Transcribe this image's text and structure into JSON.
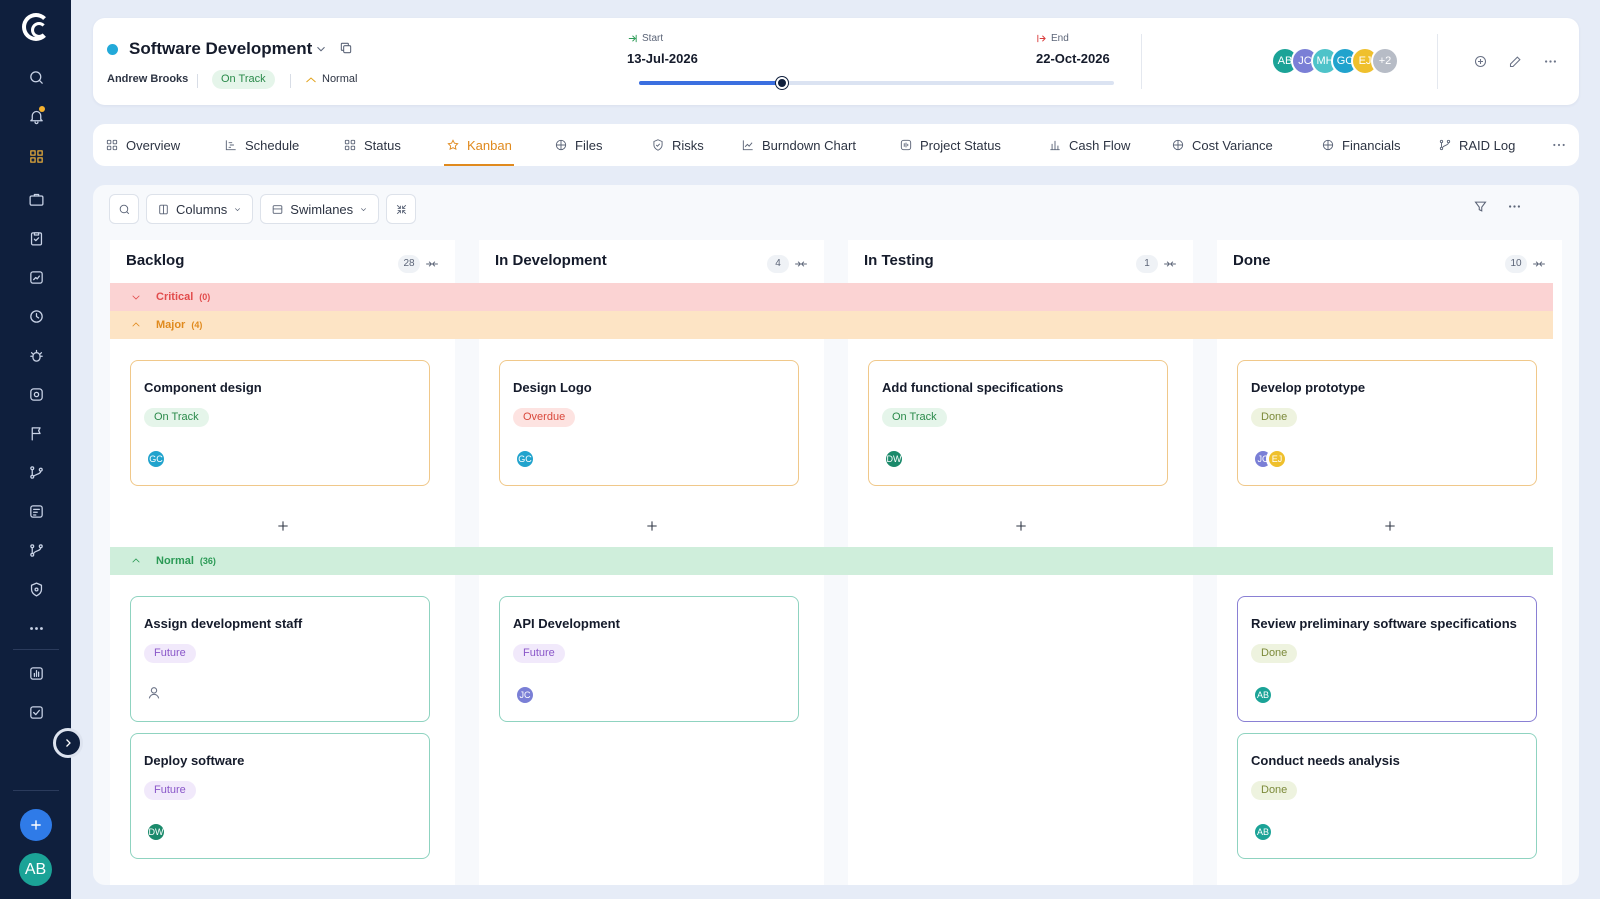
{
  "project": {
    "name": "Software Development",
    "owner": "Andrew Brooks",
    "status": "On Track",
    "priority": "Normal",
    "status_dot_color": "#22a9d9"
  },
  "schedule": {
    "start_label": "Start",
    "start_date": "13-Jul-2026",
    "end_label": "End",
    "end_date": "22-Oct-2026",
    "progress_percent": 30
  },
  "team": {
    "members": [
      {
        "initials": "AB",
        "color": "#1ba397"
      },
      {
        "initials": "JC",
        "color": "#7a7fd6"
      },
      {
        "initials": "MH",
        "color": "#4ec3c9"
      },
      {
        "initials": "GC",
        "color": "#21a3cd"
      },
      {
        "initials": "EJ",
        "color": "#efc02d"
      }
    ],
    "overflow": "+2",
    "overflow_color": "#b7bcc6"
  },
  "tabs": [
    {
      "label": "Overview",
      "icon": "grid-icon"
    },
    {
      "label": "Schedule",
      "icon": "gantt-icon"
    },
    {
      "label": "Status",
      "icon": "grid-icon"
    },
    {
      "label": "Kanban",
      "icon": "star-icon",
      "active": true
    },
    {
      "label": "Files",
      "icon": "table-icon"
    },
    {
      "label": "Risks",
      "icon": "shield-icon"
    },
    {
      "label": "Burndown Chart",
      "icon": "line-chart-icon"
    },
    {
      "label": "Project Status",
      "icon": "status-icon"
    },
    {
      "label": "Cash Flow",
      "icon": "bar-chart-icon"
    },
    {
      "label": "Cost Variance",
      "icon": "table-icon"
    },
    {
      "label": "Financials",
      "icon": "table-icon"
    },
    {
      "label": "RAID Log",
      "icon": "branch-icon"
    }
  ],
  "toolbar": {
    "columns_label": "Columns",
    "swimlanes_label": "Swimlanes"
  },
  "columns": [
    {
      "title": "Backlog",
      "count": "28"
    },
    {
      "title": "In Development",
      "count": "4"
    },
    {
      "title": "In Testing",
      "count": "1"
    },
    {
      "title": "Done",
      "count": "10"
    }
  ],
  "swimlanes": [
    {
      "name": "Critical",
      "count": "(0)",
      "bg": "#fbd3d3",
      "color": "#e24c4c",
      "expanded": false
    },
    {
      "name": "Major",
      "count": "(4)",
      "bg": "#fde4c5",
      "color": "#e08a1e",
      "expanded": true
    },
    {
      "name": "Normal",
      "count": "(36)",
      "bg": "#cfeedb",
      "color": "#2a9a55",
      "expanded": true
    }
  ],
  "cards": [
    {
      "title": "Component design",
      "status": "On Track",
      "status_kind": "green",
      "assignees": [
        {
          "initials": "GC",
          "color": "#21a3cd"
        }
      ],
      "border": "#f0c88a"
    },
    {
      "title": "Design Logo",
      "status": "Overdue",
      "status_kind": "red",
      "assignees": [
        {
          "initials": "GC",
          "color": "#21a3cd"
        }
      ],
      "border": "#f0c88a"
    },
    {
      "title": "Add functional specifications",
      "status": "On Track",
      "status_kind": "green",
      "assignees": [
        {
          "initials": "DW",
          "color": "#1b8a6b"
        }
      ],
      "border": "#f0c88a"
    },
    {
      "title": "Develop prototype",
      "status": "Done",
      "status_kind": "olive",
      "assignees": [
        {
          "initials": "JC",
          "color": "#7a7fd6"
        },
        {
          "initials": "EJ",
          "color": "#efc02d"
        }
      ],
      "border": "#f0c88a"
    },
    {
      "title": "Assign development staff",
      "status": "Future",
      "status_kind": "purple",
      "assignees": [],
      "border": "#8fd3c0"
    },
    {
      "title": "API Development",
      "status": "Future",
      "status_kind": "purple",
      "assignees": [
        {
          "initials": "JC",
          "color": "#7a7fd6"
        }
      ],
      "border": "#8fd3c0"
    },
    {
      "title": "Review preliminary software specifications",
      "status": "Done",
      "status_kind": "olive",
      "assignees": [
        {
          "initials": "AB",
          "color": "#1ba397"
        }
      ],
      "border": "#8a80d4"
    },
    {
      "title": "Deploy software",
      "status": "Future",
      "status_kind": "purple",
      "assignees": [
        {
          "initials": "DW",
          "color": "#1b8a6b"
        }
      ],
      "border": "#8fd3c0"
    },
    {
      "title": "Conduct needs analysis",
      "status": "Done",
      "status_kind": "olive",
      "assignees": [
        {
          "initials": "AB",
          "color": "#1ba397"
        }
      ],
      "border": "#8fd3c0"
    }
  ],
  "user": {
    "initials": "AB",
    "color": "#1ba397"
  },
  "colors": {
    "accent": "#e08a1e",
    "sidebar": "#0f1f3d",
    "primary": "#2f7be8"
  }
}
